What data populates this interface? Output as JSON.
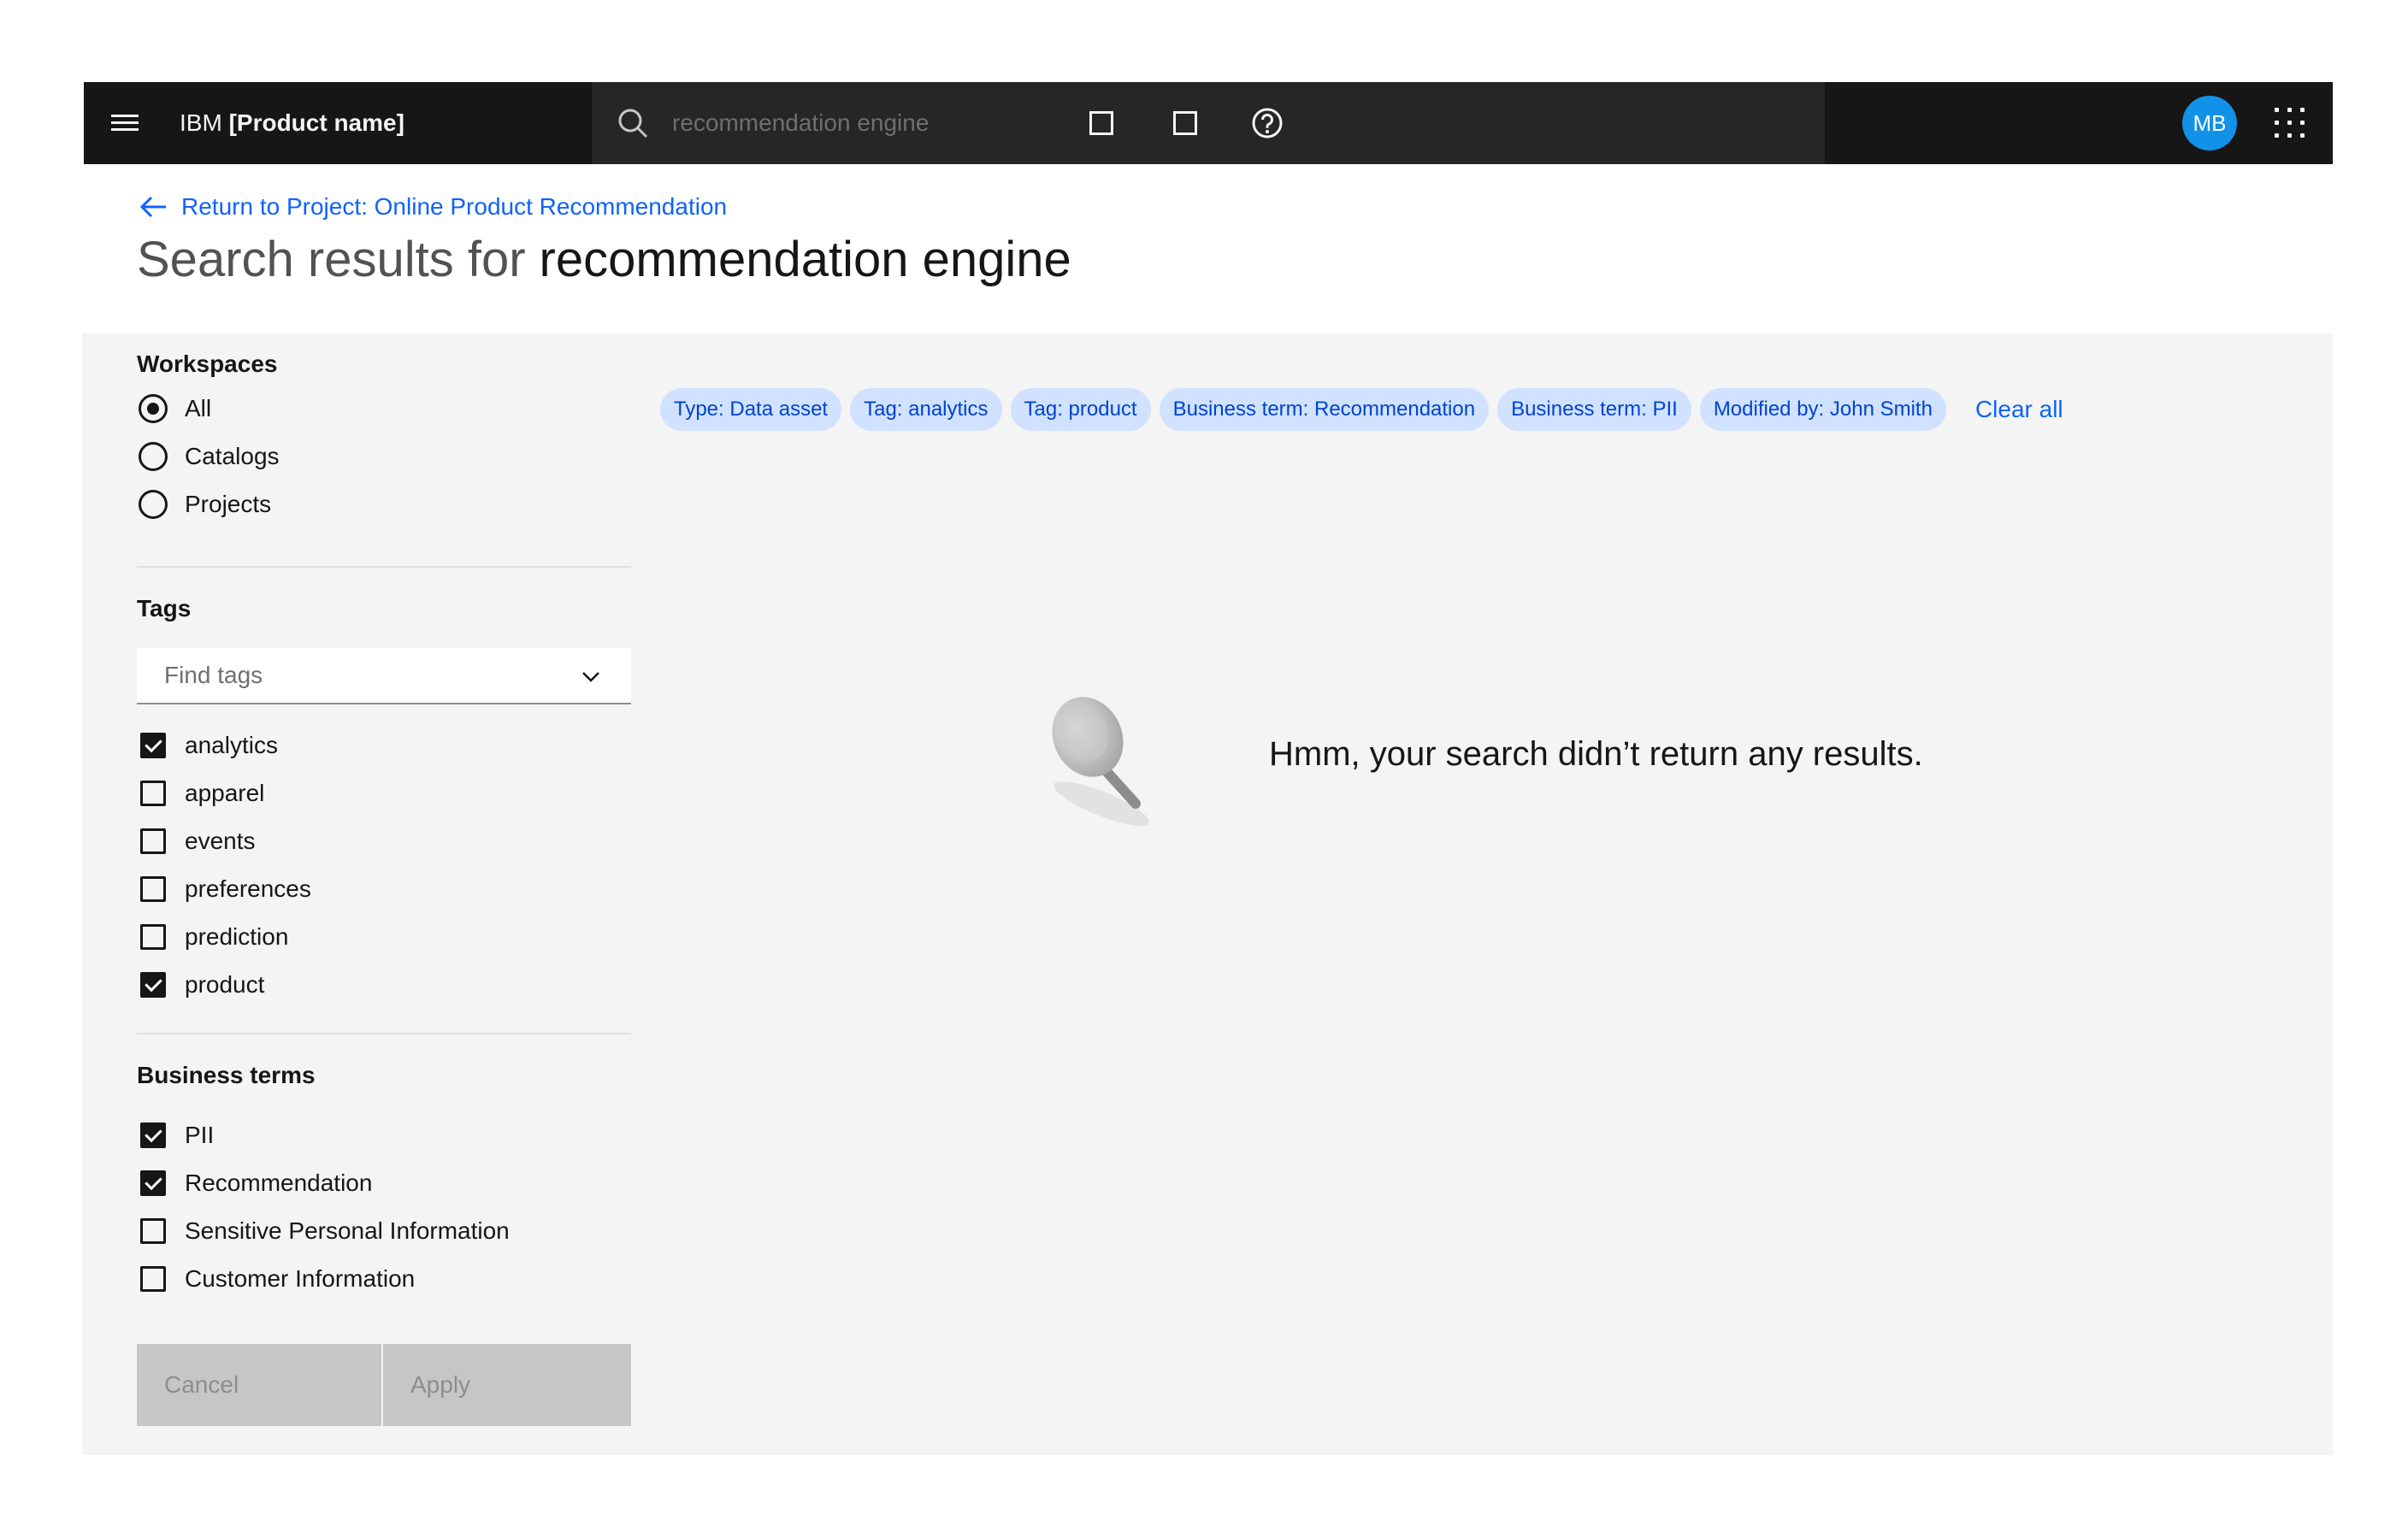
{
  "header": {
    "brand_prefix": "IBM",
    "brand_name": "[Product name]",
    "search_value": "recommendation engine",
    "avatar_initials": "MB",
    "avatar_color": "#1192e8",
    "icons": [
      "menu-icon",
      "search-icon",
      "app-icon",
      "app-icon",
      "help-icon",
      "app-switcher-icon"
    ]
  },
  "title_area": {
    "back_link": "Return to Project: Online Product Recommendation",
    "title_prefix": "Search results for",
    "title_query": "recommendation engine"
  },
  "filters": {
    "workspaces": {
      "title": "Workspaces",
      "options": [
        {
          "label": "All",
          "selected": true
        },
        {
          "label": "Catalogs",
          "selected": false
        },
        {
          "label": "Projects",
          "selected": false
        }
      ]
    },
    "tags": {
      "title": "Tags",
      "placeholder": "Find tags",
      "options": [
        {
          "label": "analytics",
          "checked": true
        },
        {
          "label": "apparel",
          "checked": false
        },
        {
          "label": "events",
          "checked": false
        },
        {
          "label": "preferences",
          "checked": false
        },
        {
          "label": "prediction",
          "checked": false
        },
        {
          "label": "product",
          "checked": true
        }
      ]
    },
    "business_terms": {
      "title": "Business terms",
      "options": [
        {
          "label": "PII",
          "checked": true
        },
        {
          "label": "Recommendation",
          "checked": true
        },
        {
          "label": "Sensitive Personal Information",
          "checked": false
        },
        {
          "label": "Customer Information",
          "checked": false
        }
      ]
    },
    "cancel_label": "Cancel",
    "apply_label": "Apply"
  },
  "active_filters": {
    "chips": [
      "Type: Data asset",
      "Tag: analytics",
      "Tag: product",
      "Business term: Recommendation",
      "Business term: PII",
      "Modified by: John Smith"
    ],
    "clear_all": "Clear all"
  },
  "empty_state": {
    "message": "Hmm, your search didn’t return any results.",
    "icon": "magnifier-icon"
  },
  "colors": {
    "header_bg": "#161616",
    "link": "#0f62fe",
    "chip_bg": "#d0e2ff",
    "panel_bg": "#f4f4f4"
  }
}
